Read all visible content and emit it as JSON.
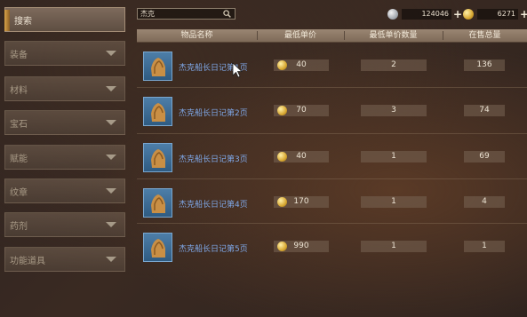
{
  "sidebar": {
    "items": [
      {
        "label": "搜索",
        "active": true
      },
      {
        "label": "装备",
        "active": false
      },
      {
        "label": "材料",
        "active": false
      },
      {
        "label": "宝石",
        "active": false
      },
      {
        "label": "赋能",
        "active": false
      },
      {
        "label": "纹章",
        "active": false
      },
      {
        "label": "药剂",
        "active": false
      },
      {
        "label": "功能道具",
        "active": false
      }
    ]
  },
  "search": {
    "value": "杰克"
  },
  "currency": {
    "silver": "124046",
    "gold": "6271"
  },
  "table": {
    "headers": [
      "物品名称",
      "最低单价",
      "最低单价数量",
      "在售总量"
    ],
    "rows": [
      {
        "name": "杰克船长日记第1页",
        "price": "40",
        "qty_at_lowest": "2",
        "total": "136"
      },
      {
        "name": "杰克船长日记第2页",
        "price": "70",
        "qty_at_lowest": "3",
        "total": "74"
      },
      {
        "name": "杰克船长日记第3页",
        "price": "40",
        "qty_at_lowest": "1",
        "total": "69"
      },
      {
        "name": "杰克船长日记第4页",
        "price": "170",
        "qty_at_lowest": "1",
        "total": "4"
      },
      {
        "name": "杰克船长日记第5页",
        "price": "990",
        "qty_at_lowest": "1",
        "total": "1"
      }
    ]
  },
  "icons": {
    "item": "scroll-page-icon",
    "coin": "gold-coin-icon",
    "silver": "silver-coin-icon",
    "search": "magnifier-icon",
    "add": "plus-icon",
    "dropdown": "chevron-down-icon"
  },
  "colors": {
    "item_name": "#7fa8e8",
    "header_bg": "#8c7865",
    "active_tab_marker": "#d9a44a"
  }
}
